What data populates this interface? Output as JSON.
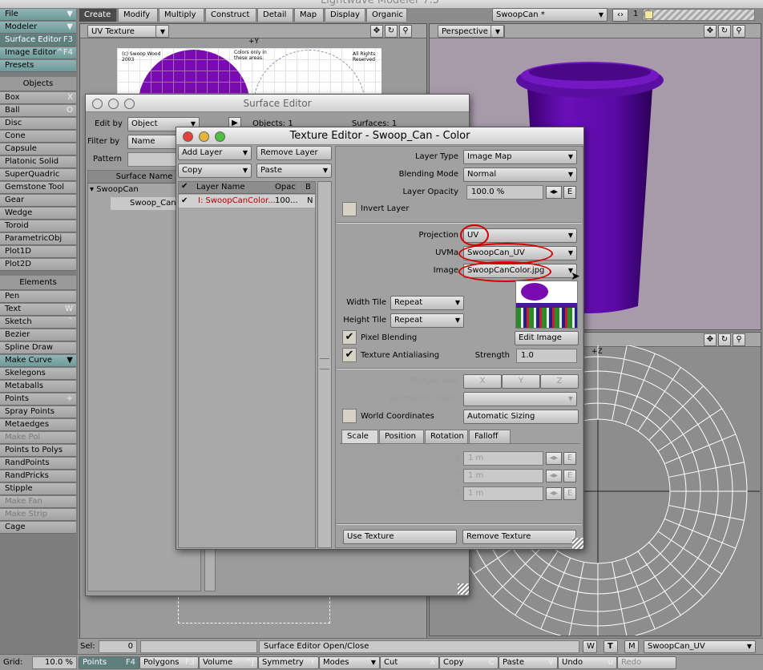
{
  "app": {
    "title": "Lightwave Modeler 7.5"
  },
  "leftbar": {
    "file": "File",
    "modeler": "Modeler",
    "surface_editor": "Surface Editor",
    "surface_editor_sc": "F3",
    "image_editor": "Image Editor",
    "image_editor_sc": "^F4",
    "presets": "Presets",
    "objects_head": "Objects",
    "objects": [
      {
        "label": "Box",
        "sc": "X"
      },
      {
        "label": "Ball",
        "sc": "O"
      },
      {
        "label": "Disc",
        "sc": ""
      },
      {
        "label": "Cone",
        "sc": ""
      },
      {
        "label": "Capsule",
        "sc": ""
      },
      {
        "label": "Platonic Solid",
        "sc": ""
      },
      {
        "label": "SuperQuadric",
        "sc": ""
      },
      {
        "label": "Gemstone Tool",
        "sc": ""
      },
      {
        "label": "Gear",
        "sc": ""
      },
      {
        "label": "Wedge",
        "sc": ""
      },
      {
        "label": "Toroid",
        "sc": ""
      },
      {
        "label": "ParametricObj",
        "sc": ""
      },
      {
        "label": "Plot1D",
        "sc": ""
      },
      {
        "label": "Plot2D",
        "sc": ""
      }
    ],
    "elements_head": "Elements",
    "elements": [
      {
        "label": "Pen",
        "sc": ""
      },
      {
        "label": "Text",
        "sc": "W"
      },
      {
        "label": "Sketch",
        "sc": "`"
      },
      {
        "label": "Bezier",
        "sc": ""
      },
      {
        "label": "Spline Draw",
        "sc": ""
      },
      {
        "label": "Make Curve",
        "sc": ""
      },
      {
        "label": "Skelegons",
        "sc": ""
      },
      {
        "label": "Metaballs",
        "sc": ""
      },
      {
        "label": "Points",
        "sc": "+"
      },
      {
        "label": "Spray Points",
        "sc": ""
      },
      {
        "label": "Metaedges",
        "sc": ""
      },
      {
        "label": "Make Pol",
        "sc": ""
      },
      {
        "label": "Points to Polys",
        "sc": ""
      },
      {
        "label": "RandPoints",
        "sc": ""
      },
      {
        "label": "RandPricks",
        "sc": ""
      },
      {
        "label": "Stipple",
        "sc": ""
      },
      {
        "label": "Make Fan",
        "sc": ""
      },
      {
        "label": "Make Strip",
        "sc": ""
      },
      {
        "label": "Cage",
        "sc": ""
      }
    ]
  },
  "tabs": [
    "Create",
    "Modify",
    "Multiply",
    "Construct",
    "Detail",
    "Map",
    "Display",
    "Organic"
  ],
  "topright": {
    "object": "SwoopCan *",
    "layer": "1"
  },
  "viewports": {
    "left_mode": "UV Texture",
    "right_mode": "Perspective",
    "axis_y": "+Y",
    "axis_z": "+Z"
  },
  "uvimage": {
    "text1": "(c) Swoop Wood\n2003",
    "text2": "Colors only in\nthese areas.",
    "text3": "All Rights\nReserved"
  },
  "surface_editor": {
    "title": "Surface Editor",
    "edit_by_label": "Edit by",
    "edit_by": "Object",
    "filter_by_label": "Filter by",
    "filter_by": "Name",
    "pattern_label": "Pattern",
    "objects": "Objects: 1",
    "surfaces": "Surfaces: 1",
    "col_surface_name": "Surface Name",
    "tree_root": "SwoopCan",
    "tree_child": "Swoop_Can"
  },
  "texture_editor": {
    "title": "Texture Editor - Swoop_Can - Color",
    "add_layer": "Add Layer",
    "remove_layer": "Remove Layer",
    "copy": "Copy",
    "paste": "Paste",
    "col_layer_name": "Layer Name",
    "col_opac": "Opac",
    "col_b": "B",
    "layer_row": {
      "name": "I: SwoopCanColor...",
      "opac": "100...",
      "b": "N"
    },
    "layer_type_label": "Layer Type",
    "layer_type": "Image Map",
    "blending_label": "Blending Mode",
    "blending": "Normal",
    "opacity_label": "Layer Opacity",
    "opacity": "100.0 %",
    "env_e": "E",
    "invert_layer": "Invert Layer",
    "projection_label": "Projection",
    "projection": "UV",
    "uvmap_label": "UVMa",
    "uvmap": "SwoopCan_UV",
    "image_label": "Image",
    "image": "SwoopCanColor.jpg",
    "width_tile_label": "Width Tile",
    "width_tile": "Repeat",
    "height_tile_label": "Height Tile",
    "height_tile": "Repeat",
    "pixel_blending": "Pixel Blending",
    "edit_image": "Edit Image",
    "texture_aa": "Texture Antialiasing",
    "strength_label": "Strength",
    "strength": "1.0",
    "texture_axis_label": "Texture Axis",
    "axis_x": "X",
    "axis_y": "Y",
    "axis_z": "Z",
    "reference_object_label": "Reference Object",
    "world_coords": "World Coordinates",
    "auto_sizing": "Automatic Sizing",
    "subtabs": [
      "Scale",
      "Position",
      "Rotation",
      "Falloff"
    ],
    "x_label": "X",
    "y_label": "Y",
    "z_label": "Z",
    "x_val": "1 m",
    "y_val": "1 m",
    "z_val": "1 m",
    "use_texture": "Use Texture",
    "remove_texture": "Remove Texture"
  },
  "statusbar": {
    "sel_label": "Sel:",
    "sel": "0",
    "message": "Surface Editor Open/Close",
    "w": "W",
    "t": "T",
    "m": "M",
    "uvmap": "SwoopCan_UV",
    "grid_label": "Grid:",
    "grid": "10.0 %",
    "buttons": [
      {
        "label": "Points",
        "sc": "F4"
      },
      {
        "label": "Polygons",
        "sc": "F3"
      },
      {
        "label": "Volume",
        "sc": "^J"
      },
      {
        "label": "Symmetry",
        "sc": "Y"
      },
      {
        "label": "Modes",
        "sc": ""
      },
      {
        "label": "Cut",
        "sc": "X"
      },
      {
        "label": "Copy",
        "sc": "C"
      },
      {
        "label": "Paste",
        "sc": "V"
      },
      {
        "label": "Undo",
        "sc": "u"
      },
      {
        "label": "Redo",
        "sc": ""
      }
    ]
  }
}
